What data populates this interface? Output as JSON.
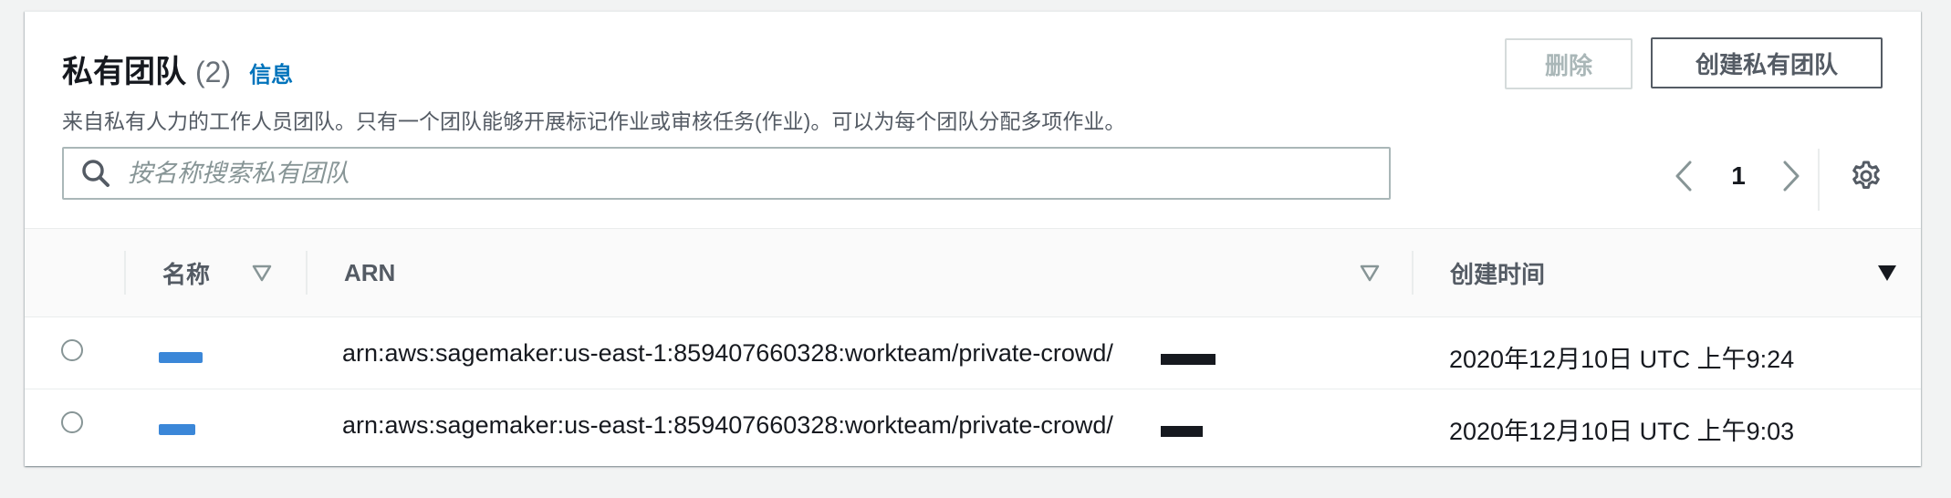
{
  "header": {
    "title": "私有团队",
    "count": "(2)",
    "info_link": "信息",
    "description": "来自私有人力的工作人员团队。只有一个团队能够开展标记作业或审核任务(作业)。可以为每个团队分配多项作业。"
  },
  "actions": {
    "delete_label": "删除",
    "create_label": "创建私有团队"
  },
  "search": {
    "placeholder": "按名称搜索私有团队",
    "value": ""
  },
  "pagination": {
    "current_page": "1"
  },
  "table": {
    "columns": [
      {
        "label": "名称",
        "sort": "filter-triangle-icon"
      },
      {
        "label": "ARN",
        "sort": "filter-triangle-icon"
      },
      {
        "label": "创建时间",
        "sort": "sort-descending-icon"
      }
    ],
    "rows": [
      {
        "name": "",
        "arn": "arn:aws:sagemaker:us-east-1:859407660328:workteam/private-crowd/",
        "created": "2020年12月10日 UTC 上午9:24"
      },
      {
        "name": "",
        "arn": "arn:aws:sagemaker:us-east-1:859407660328:workteam/private-crowd/",
        "created": "2020年12月10日 UTC 上午9:03"
      }
    ]
  },
  "colors": {
    "link": "#0073bb",
    "text_primary": "#16191f",
    "text_secondary": "#545b64",
    "border": "#aab7b8",
    "redaction": "#3b87d8"
  }
}
